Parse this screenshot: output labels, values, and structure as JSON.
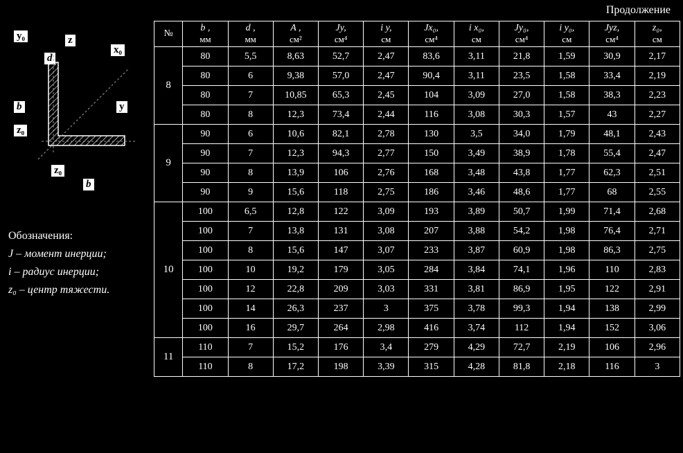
{
  "continuation_label": "Продолжение",
  "diagram_labels": {
    "y0_top": "y₀",
    "z_top": "z",
    "x0_top": "x₀",
    "d": "d",
    "b_left": "b",
    "y_right": "y",
    "z0_left": "z₀",
    "z0_bottom": "z₀",
    "b_bottom": "b"
  },
  "notes": {
    "heading": "Обозначения:",
    "line1": "J – момент инерции;",
    "line2": "i – радиус инерции;",
    "line3": "z₀ – центр тяжести."
  },
  "table": {
    "headers": {
      "num": "№",
      "b": {
        "top": "b ,",
        "bot": "мм"
      },
      "d": {
        "top": "d ,",
        "bot": "мм"
      },
      "A": {
        "top": "A ,",
        "bot": "см²"
      },
      "Jy": {
        "top": "Jy,",
        "bot": "см⁴"
      },
      "iy": {
        "top": "i y,",
        "bot": "см"
      },
      "Jx0": {
        "top": "Jx₀,",
        "bot": "см⁴"
      },
      "ix0": {
        "top": "i x₀,",
        "bot": "см"
      },
      "Jy0": {
        "top": "Jy₀,",
        "bot": "см⁴"
      },
      "iy0": {
        "top": "i y₀,",
        "bot": "см"
      },
      "Jyz": {
        "top": "Jyz,",
        "bot": "см⁴"
      },
      "z0": {
        "top": "z₀,",
        "bot": "см"
      }
    },
    "groups": [
      {
        "num": "8",
        "rows": [
          {
            "b": "80",
            "d": "5,5",
            "A": "8,63",
            "Jy": "52,7",
            "iy": "2,47",
            "Jx0": "83,6",
            "ix0": "3,11",
            "Jy0": "21,8",
            "iy0": "1,59",
            "Jyz": "30,9",
            "z0": "2,17"
          },
          {
            "b": "80",
            "d": "6",
            "A": "9,38",
            "Jy": "57,0",
            "iy": "2,47",
            "Jx0": "90,4",
            "ix0": "3,11",
            "Jy0": "23,5",
            "iy0": "1,58",
            "Jyz": "33,4",
            "z0": "2,19"
          },
          {
            "b": "80",
            "d": "7",
            "A": "10,85",
            "Jy": "65,3",
            "iy": "2,45",
            "Jx0": "104",
            "ix0": "3,09",
            "Jy0": "27,0",
            "iy0": "1,58",
            "Jyz": "38,3",
            "z0": "2,23"
          },
          {
            "b": "80",
            "d": "8",
            "A": "12,3",
            "Jy": "73,4",
            "iy": "2,44",
            "Jx0": "116",
            "ix0": "3,08",
            "Jy0": "30,3",
            "iy0": "1,57",
            "Jyz": "43",
            "z0": "2,27"
          }
        ]
      },
      {
        "num": "9",
        "rows": [
          {
            "b": "90",
            "d": "6",
            "A": "10,6",
            "Jy": "82,1",
            "iy": "2,78",
            "Jx0": "130",
            "ix0": "3,5",
            "Jy0": "34,0",
            "iy0": "1,79",
            "Jyz": "48,1",
            "z0": "2,43"
          },
          {
            "b": "90",
            "d": "7",
            "A": "12,3",
            "Jy": "94,3",
            "iy": "2,77",
            "Jx0": "150",
            "ix0": "3,49",
            "Jy0": "38,9",
            "iy0": "1,78",
            "Jyz": "55,4",
            "z0": "2,47"
          },
          {
            "b": "90",
            "d": "8",
            "A": "13,9",
            "Jy": "106",
            "iy": "2,76",
            "Jx0": "168",
            "ix0": "3,48",
            "Jy0": "43,8",
            "iy0": "1,77",
            "Jyz": "62,3",
            "z0": "2,51"
          },
          {
            "b": "90",
            "d": "9",
            "A": "15,6",
            "Jy": "118",
            "iy": "2,75",
            "Jx0": "186",
            "ix0": "3,46",
            "Jy0": "48,6",
            "iy0": "1,77",
            "Jyz": "68",
            "z0": "2,55"
          }
        ]
      },
      {
        "num": "10",
        "rows": [
          {
            "b": "100",
            "d": "6,5",
            "A": "12,8",
            "Jy": "122",
            "iy": "3,09",
            "Jx0": "193",
            "ix0": "3,89",
            "Jy0": "50,7",
            "iy0": "1,99",
            "Jyz": "71,4",
            "z0": "2,68"
          },
          {
            "b": "100",
            "d": "7",
            "A": "13,8",
            "Jy": "131",
            "iy": "3,08",
            "Jx0": "207",
            "ix0": "3,88",
            "Jy0": "54,2",
            "iy0": "1,98",
            "Jyz": "76,4",
            "z0": "2,71"
          },
          {
            "b": "100",
            "d": "8",
            "A": "15,6",
            "Jy": "147",
            "iy": "3,07",
            "Jx0": "233",
            "ix0": "3,87",
            "Jy0": "60,9",
            "iy0": "1,98",
            "Jyz": "86,3",
            "z0": "2,75"
          },
          {
            "b": "100",
            "d": "10",
            "A": "19,2",
            "Jy": "179",
            "iy": "3,05",
            "Jx0": "284",
            "ix0": "3,84",
            "Jy0": "74,1",
            "iy0": "1,96",
            "Jyz": "110",
            "z0": "2,83"
          },
          {
            "b": "100",
            "d": "12",
            "A": "22,8",
            "Jy": "209",
            "iy": "3,03",
            "Jx0": "331",
            "ix0": "3,81",
            "Jy0": "86,9",
            "iy0": "1,95",
            "Jyz": "122",
            "z0": "2,91"
          },
          {
            "b": "100",
            "d": "14",
            "A": "26,3",
            "Jy": "237",
            "iy": "3",
            "Jx0": "375",
            "ix0": "3,78",
            "Jy0": "99,3",
            "iy0": "1,94",
            "Jyz": "138",
            "z0": "2,99"
          },
          {
            "b": "100",
            "d": "16",
            "A": "29,7",
            "Jy": "264",
            "iy": "2,98",
            "Jx0": "416",
            "ix0": "3,74",
            "Jy0": "112",
            "iy0": "1,94",
            "Jyz": "152",
            "z0": "3,06"
          }
        ]
      },
      {
        "num": "11",
        "rows": [
          {
            "b": "110",
            "d": "7",
            "A": "15,2",
            "Jy": "176",
            "iy": "3,4",
            "Jx0": "279",
            "ix0": "4,29",
            "Jy0": "72,7",
            "iy0": "2,19",
            "Jyz": "106",
            "z0": "2,96"
          },
          {
            "b": "110",
            "d": "8",
            "A": "17,2",
            "Jy": "198",
            "iy": "3,39",
            "Jx0": "315",
            "ix0": "4,28",
            "Jy0": "81,8",
            "iy0": "2,18",
            "Jyz": "116",
            "z0": "3"
          }
        ]
      }
    ]
  }
}
